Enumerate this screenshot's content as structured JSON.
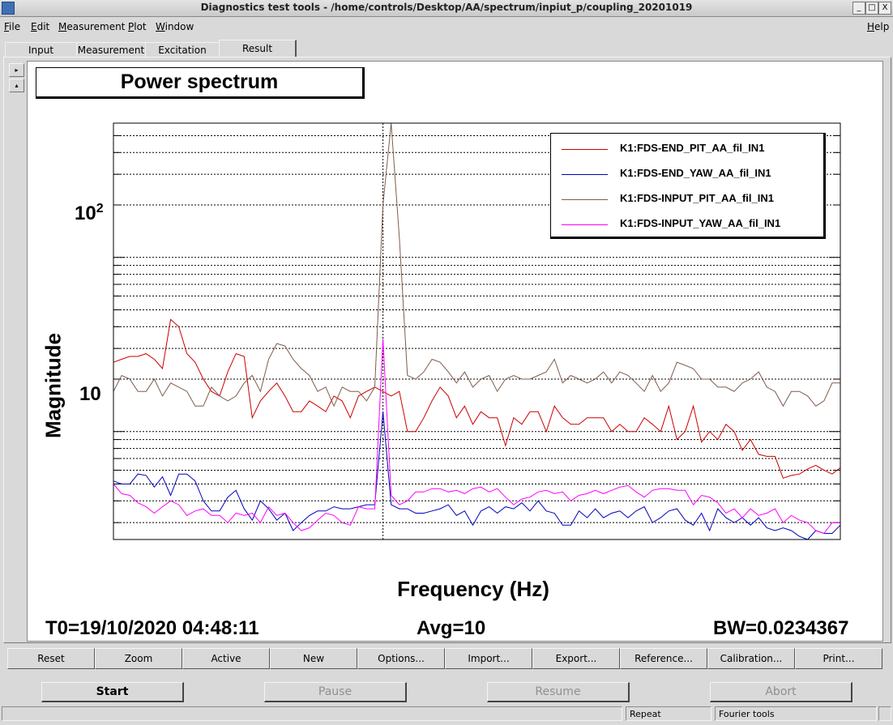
{
  "window": {
    "title": "Diagnostics test tools - /home/controls/Desktop/AA/spectrum/inpiut_p/coupling_20201019",
    "buttons": [
      "_",
      "□",
      "X"
    ]
  },
  "menu": {
    "items": [
      "File",
      "Edit",
      "Measurement",
      "Plot",
      "Window"
    ],
    "help": "Help"
  },
  "tabs": [
    "Input",
    "Measurement",
    "Excitation",
    "Result"
  ],
  "active_tab": "Result",
  "side_arrows": [
    "▸",
    "▴"
  ],
  "plot": {
    "title": "Power spectrum",
    "t0": "T0=19/10/2020 04:48:11",
    "avg": "Avg=10",
    "bw": "BW=0.0234367"
  },
  "chart_data": {
    "type": "line",
    "title": "Power spectrum",
    "xlabel": "Frequency (Hz)",
    "ylabel": "Magnitude",
    "yscale": "log",
    "ylim": [
      2.4,
      590
    ],
    "ytick_labels": [
      {
        "value": 100,
        "base": "10",
        "exp": "2"
      },
      {
        "value": 10,
        "base": "10",
        "exp": ""
      }
    ],
    "x": [
      0,
      1,
      2,
      3,
      4,
      5,
      6,
      7,
      8,
      9,
      10,
      11,
      12,
      13,
      14,
      15,
      16,
      17,
      18,
      19,
      20,
      21,
      22,
      23,
      24,
      25,
      26,
      27,
      28,
      29,
      30,
      31,
      32,
      33,
      34,
      35,
      36,
      37,
      38,
      39,
      40,
      41,
      42,
      43,
      44,
      45,
      46,
      47,
      48,
      49,
      50,
      51,
      52,
      53,
      54,
      55,
      56,
      57,
      58,
      59,
      60,
      61,
      62,
      63,
      64,
      65,
      66,
      67,
      68,
      69,
      70,
      71,
      72,
      73,
      74,
      75,
      76,
      77,
      78,
      79,
      80,
      81,
      82,
      83,
      84,
      85,
      86,
      87,
      88,
      89
    ],
    "marker_index": 33,
    "grid": true,
    "legend_position": "top-right",
    "series": [
      {
        "name": "K1:FDS-END_PIT_AA_fil_IN1",
        "color": "#cc0000",
        "values": [
          25,
          26,
          27,
          27,
          28,
          26,
          23,
          44,
          40,
          28,
          25,
          20,
          17,
          16,
          22,
          28,
          27,
          12,
          15,
          17,
          19,
          16,
          13,
          13,
          15,
          14,
          13,
          16,
          15,
          12,
          16,
          17,
          18,
          17,
          16,
          17,
          10,
          10,
          12,
          15,
          18,
          16,
          12,
          14,
          11,
          13,
          12,
          12,
          8.3,
          12,
          11,
          13,
          13,
          10,
          14,
          12,
          11,
          11,
          12,
          12,
          12,
          10,
          11,
          10,
          10,
          12,
          11,
          10,
          14,
          9,
          10,
          14,
          8.7,
          10,
          9,
          11,
          10,
          7.8,
          9,
          7.4,
          7.2,
          7.2,
          5.4,
          5.6,
          5.7,
          6.1,
          6.4,
          6.0,
          5.7,
          6.2
        ]
      },
      {
        "name": "K1:FDS-END_YAW_AA_fil_IN1",
        "color": "#0000bb",
        "values": [
          5.2,
          5.0,
          5.0,
          5.7,
          5.6,
          4.8,
          5.5,
          4.3,
          5.7,
          5.7,
          5.2,
          4.0,
          3.5,
          3.5,
          4.2,
          4.6,
          3.6,
          3.1,
          4.0,
          3.6,
          3.1,
          3.4,
          2.7,
          3.0,
          3.3,
          3.5,
          3.5,
          3.7,
          3.6,
          3.6,
          3.7,
          3.8,
          3.8,
          13,
          3.8,
          3.6,
          3.6,
          3.4,
          3.4,
          3.5,
          3.6,
          3.8,
          3.3,
          3.5,
          2.9,
          3.5,
          3.7,
          3.4,
          3.7,
          3.6,
          3.9,
          3.5,
          4.0,
          3.5,
          3.4,
          2.9,
          2.9,
          3.5,
          3.2,
          3.6,
          3.2,
          3.4,
          3.5,
          3.2,
          3.5,
          3.7,
          3.0,
          3.2,
          3.5,
          3.6,
          3.1,
          2.9,
          3.4,
          2.7,
          3.6,
          3.2,
          3.0,
          3.2,
          2.9,
          3.2,
          2.8,
          2.7,
          2.8,
          2.7,
          2.5,
          2.4,
          2.7,
          2.6,
          2.6,
          2.9
        ]
      },
      {
        "name": "K1:FDS-INPUT_PIT_AA_fil_IN1",
        "color": "#7f5c4c",
        "values": [
          17,
          21,
          20,
          17,
          17,
          20,
          16,
          19,
          18,
          17,
          14,
          14,
          18,
          16,
          15,
          16,
          19,
          21,
          17,
          26,
          32,
          31,
          26,
          23,
          21,
          17,
          18,
          14,
          18,
          17,
          17,
          15,
          18,
          200,
          590,
          130,
          21,
          20,
          22,
          26,
          25,
          22,
          19,
          22,
          18,
          20,
          21,
          17,
          20,
          21,
          20,
          20,
          21,
          22,
          26,
          19,
          21,
          20,
          19,
          20,
          22,
          19,
          22,
          21,
          19,
          17,
          21,
          17,
          19,
          25,
          24,
          23,
          20,
          20,
          18,
          18,
          17,
          19,
          20,
          22,
          18,
          17,
          14,
          17,
          17,
          16,
          14,
          15,
          19,
          19
        ]
      },
      {
        "name": "K1:FDS-INPUT_YAW_AA_fil_IN1",
        "color": "#ff00ff",
        "values": [
          5.0,
          4.4,
          4.3,
          3.9,
          3.7,
          3.4,
          3.7,
          4.0,
          3.8,
          3.3,
          3.5,
          3.6,
          3.3,
          3.3,
          3.0,
          3.4,
          3.3,
          3.4,
          3.0,
          3.7,
          3.3,
          3.4,
          3.0,
          2.7,
          2.8,
          3.1,
          3.4,
          3.3,
          3.0,
          2.9,
          3.7,
          3.6,
          3.6,
          34,
          4.3,
          3.8,
          4.0,
          4.5,
          4.5,
          4.7,
          4.7,
          4.5,
          4.6,
          4.4,
          4.7,
          4.8,
          4.5,
          4.7,
          4.2,
          3.8,
          4.1,
          4.2,
          4.5,
          4.6,
          4.4,
          4.5,
          4.0,
          4.3,
          4.4,
          4.6,
          4.4,
          4.6,
          4.8,
          4.9,
          4.5,
          4.2,
          4.6,
          4.7,
          4.7,
          4.6,
          4.6,
          3.8,
          4.3,
          4.2,
          3.9,
          3.4,
          3.6,
          3.2,
          3.6,
          3.3,
          3.4,
          3.6,
          3.0,
          3.3,
          3.1,
          3.0,
          2.7,
          2.6,
          3.0,
          3.0
        ]
      }
    ]
  },
  "toolbar": [
    "Reset",
    "Zoom",
    "Active",
    "New",
    "Options...",
    "Import...",
    "Export...",
    "Reference...",
    "Calibration...",
    "Print..."
  ],
  "run_buttons": [
    {
      "label": "Start",
      "enabled": true
    },
    {
      "label": "Pause",
      "enabled": false
    },
    {
      "label": "Resume",
      "enabled": false
    },
    {
      "label": "Abort",
      "enabled": false
    }
  ],
  "status": {
    "cells": [
      "",
      "Repeat",
      "Fourier tools"
    ]
  }
}
